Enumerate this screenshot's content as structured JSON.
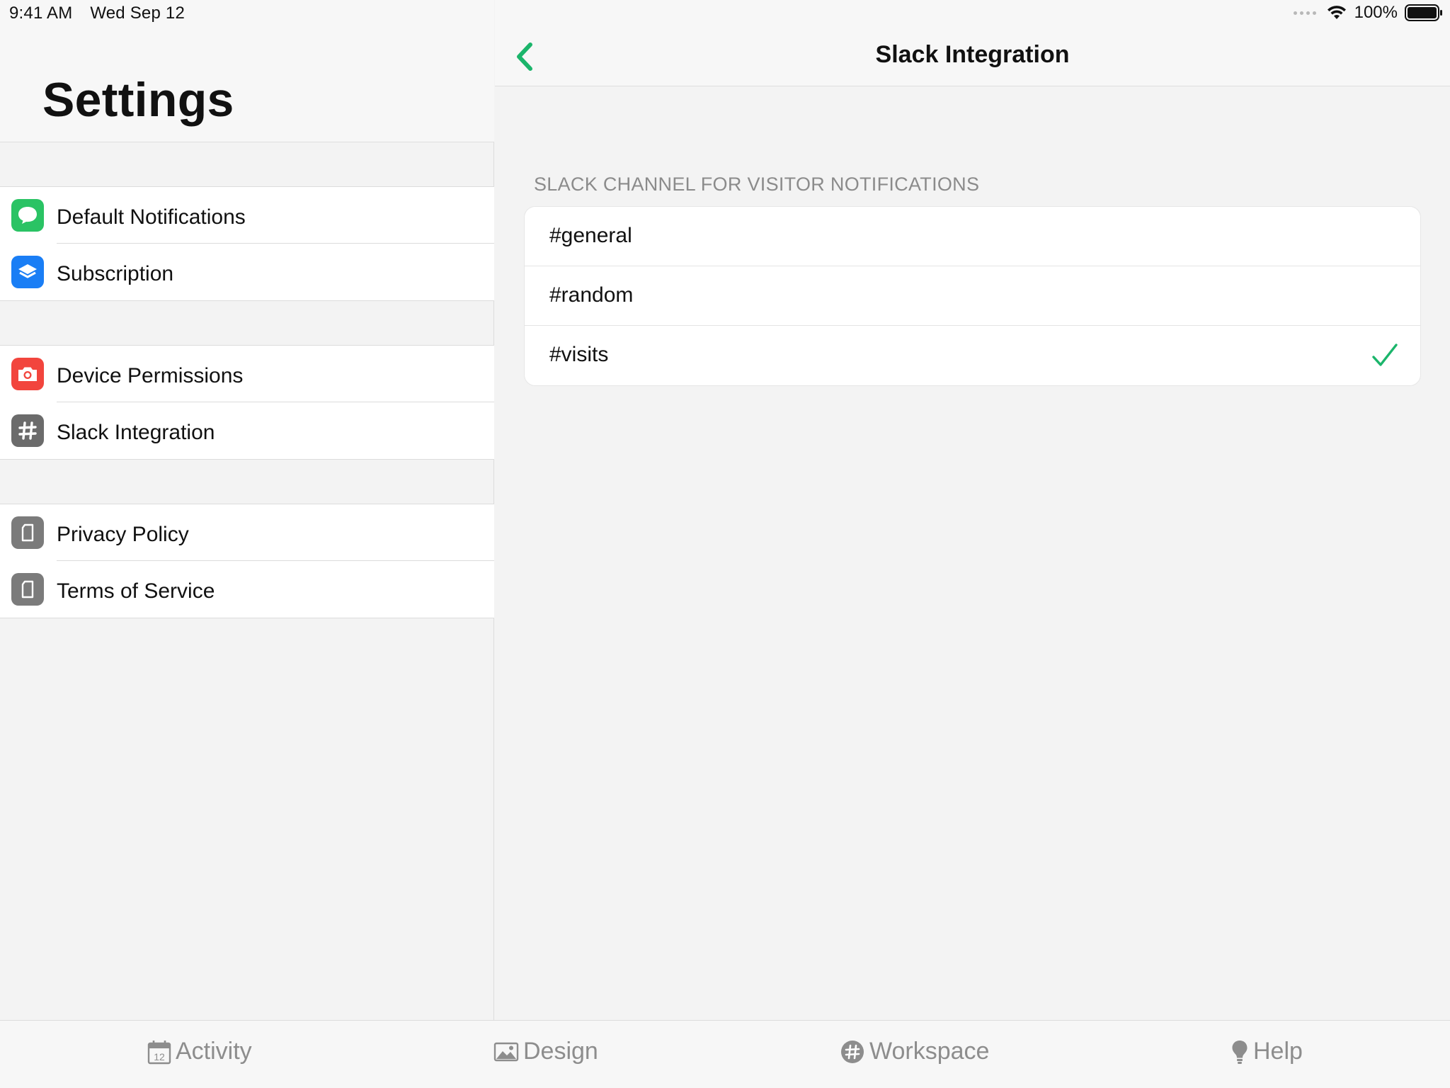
{
  "status_bar": {
    "time": "9:41 AM",
    "date": "Wed Sep 12",
    "battery": "100%"
  },
  "master": {
    "title": "Settings",
    "groups": [
      {
        "items": [
          {
            "label": "Default Notifications",
            "icon": "message-bubble-icon",
            "icon_color": "#2ac364"
          },
          {
            "label": "Subscription",
            "icon": "layers-icon",
            "icon_color": "#1a7ef5"
          }
        ]
      },
      {
        "items": [
          {
            "label": "Device Permissions",
            "icon": "camera-icon",
            "icon_color": "#f2453d"
          },
          {
            "label": "Slack Integration",
            "icon": "hashtag-icon",
            "icon_color": "#6b6b6b"
          }
        ]
      },
      {
        "items": [
          {
            "label": "Privacy Policy",
            "icon": "document-icon",
            "icon_color": "#7b7b7b"
          },
          {
            "label": "Terms of Service",
            "icon": "document-icon",
            "icon_color": "#7b7b7b"
          }
        ]
      }
    ]
  },
  "detail": {
    "title": "Slack Integration",
    "section_header": "SLACK CHANNEL FOR VISITOR NOTIFICATIONS",
    "channels": [
      {
        "label": "#general",
        "selected": false
      },
      {
        "label": "#random",
        "selected": false
      },
      {
        "label": "#visits",
        "selected": true
      }
    ]
  },
  "tab_bar": {
    "tabs": [
      {
        "label": "Activity",
        "icon": "calendar-icon",
        "icon_text": "12"
      },
      {
        "label": "Design",
        "icon": "image-icon"
      },
      {
        "label": "Workspace",
        "icon": "hashtag-circle-icon"
      },
      {
        "label": "Help",
        "icon": "lightbulb-icon"
      }
    ]
  },
  "colors": {
    "accent": "#1bb56b",
    "background": "#f3f3f3",
    "inactive_tab": "#8d8d8d"
  }
}
